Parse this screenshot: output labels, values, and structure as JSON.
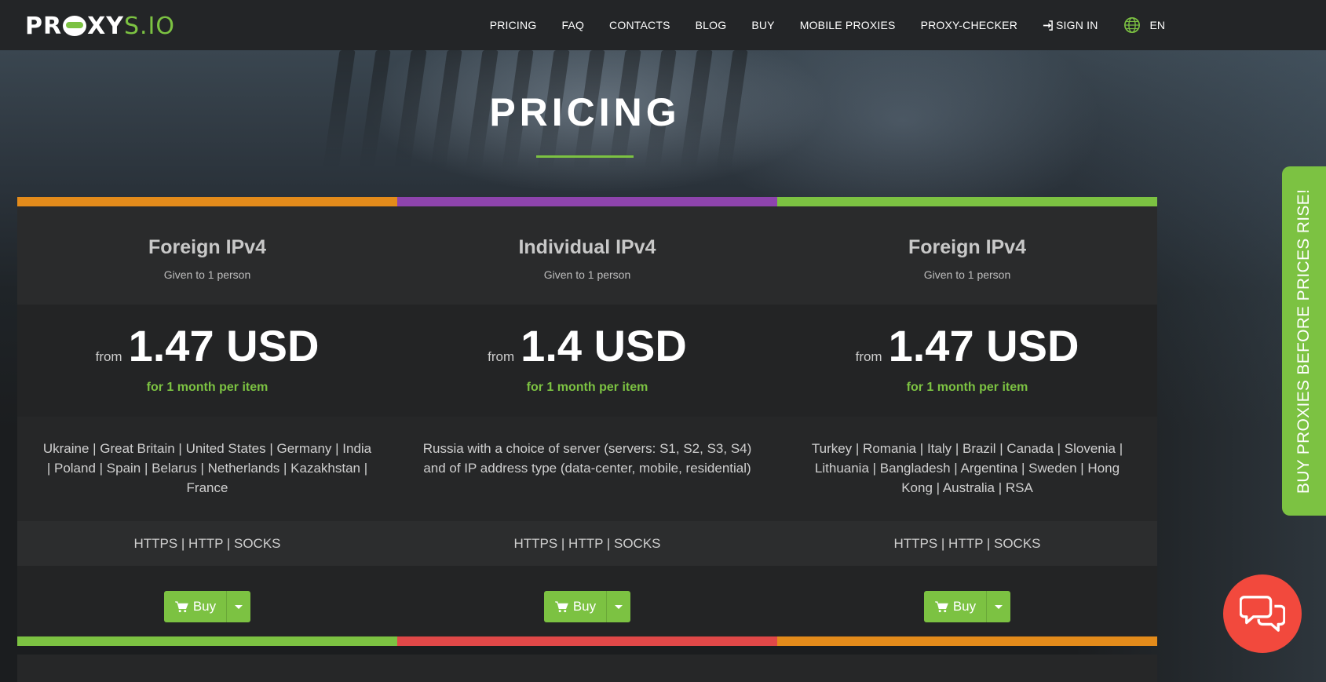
{
  "brand": {
    "logo_left": "PR",
    "logo_mid": "XY",
    "logo_right": "S.IO",
    "accent": "#7cc242"
  },
  "nav": {
    "items": [
      "PRICING",
      "FAQ",
      "CONTACTS",
      "BLOG",
      "BUY",
      "MOBILE PROXIES",
      "PROXY-CHECKER"
    ],
    "signin": "SIGN IN",
    "language": "EN"
  },
  "page": {
    "title": "PRICING"
  },
  "cards": [
    {
      "stripe_color": "#e38b1b",
      "bottom_stripe_color": "#7cc242",
      "name": "Foreign IPv4",
      "subtitle": "Given to 1 person",
      "from": "from",
      "price": "1.47 USD",
      "period": "for 1 month per item",
      "countries": "Ukraine | Great Britain | United States | Germany | India | Poland | Spain | Belarus | Netherlands | Kazakhstan | France",
      "protocols": "HTTPS | HTTP | SOCKS",
      "buy_label": "Buy"
    },
    {
      "stripe_color": "#8e44ad",
      "bottom_stripe_color": "#e04848",
      "name": "Individual IPv4",
      "subtitle": "Given to 1 person",
      "from": "from",
      "price": "1.4 USD",
      "period": "for 1 month per item",
      "countries": "Russia with a choice of server (servers: S1, S2, S3, S4) and of IP address type (data-center, mobile, residential)",
      "protocols": "HTTPS | HTTP | SOCKS",
      "buy_label": "Buy"
    },
    {
      "stripe_color": "#7cc242",
      "bottom_stripe_color": "#e38b1b",
      "name": "Foreign IPv4",
      "subtitle": "Given to 1 person",
      "from": "from",
      "price": "1.47 USD",
      "period": "for 1 month per item",
      "countries": "Turkey | Romania | Italy | Brazil | Canada | Slovenia | Lithuania | Bangladesh | Argentina | Sweden | Hong Kong | Australia | RSA",
      "protocols": "HTTPS | HTTP | SOCKS",
      "buy_label": "Buy"
    }
  ],
  "promo": {
    "text": "BUY PROXIES BEFORE PRICES RISE!"
  },
  "chat": {
    "icon": "chat-bubbles-icon",
    "color": "#f2493d"
  }
}
